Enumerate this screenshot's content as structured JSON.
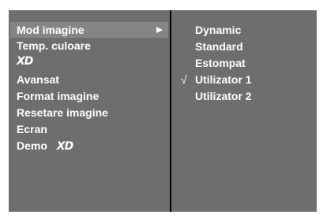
{
  "menu": {
    "items": [
      {
        "label": "Mod imagine"
      },
      {
        "label": "Temp. culoare"
      },
      {
        "label": "XD"
      },
      {
        "label": "Avansat"
      },
      {
        "label": "Format imagine"
      },
      {
        "label": "Resetare imagine"
      },
      {
        "label": "Ecran"
      },
      {
        "label": "Demo",
        "badge": "XD"
      }
    ]
  },
  "submenu": {
    "check_mark": "√",
    "items": [
      {
        "label": "Dynamic"
      },
      {
        "label": "Standard"
      },
      {
        "label": "Estompat"
      },
      {
        "label": "Utilizator 1",
        "checked": true
      },
      {
        "label": "Utilizator 2"
      }
    ]
  },
  "colors": {
    "panel": "#6e6e6e",
    "highlight": "#858585",
    "divider": "#000000",
    "text": "#ffffff"
  }
}
